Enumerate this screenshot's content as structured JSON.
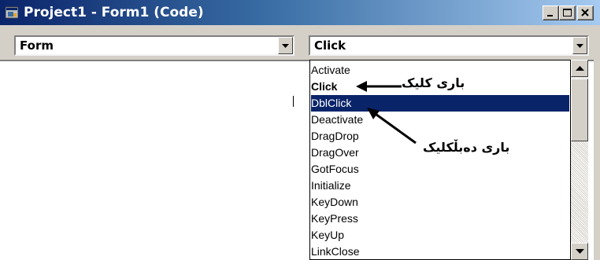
{
  "window": {
    "title": "Project1 - Form1 (Code)",
    "icon": "vb-form-icon",
    "buttons": [
      "minimize-icon",
      "maximize-icon",
      "close-icon"
    ]
  },
  "object_combo": {
    "value": "Form"
  },
  "procedure_combo": {
    "value": "Click"
  },
  "procedure_list": {
    "items": [
      {
        "label": "Activate"
      },
      {
        "label": "Click"
      },
      {
        "label": "DblClick"
      },
      {
        "label": "Deactivate"
      },
      {
        "label": "DragDrop"
      },
      {
        "label": "DragOver"
      },
      {
        "label": "GotFocus"
      },
      {
        "label": "Initialize"
      },
      {
        "label": "KeyDown"
      },
      {
        "label": "KeyPress"
      },
      {
        "label": "KeyUp"
      },
      {
        "label": "LinkClose"
      }
    ],
    "selected": "DblClick",
    "bold": "Click"
  },
  "annotations": {
    "click_note": "باری کلیک",
    "dblclick_note": "باری دەبڵکلیک"
  },
  "colors": {
    "title_start": "#0a246a",
    "title_end": "#a6caf0",
    "selection": "#0a246a",
    "face": "#d4d0c8"
  }
}
